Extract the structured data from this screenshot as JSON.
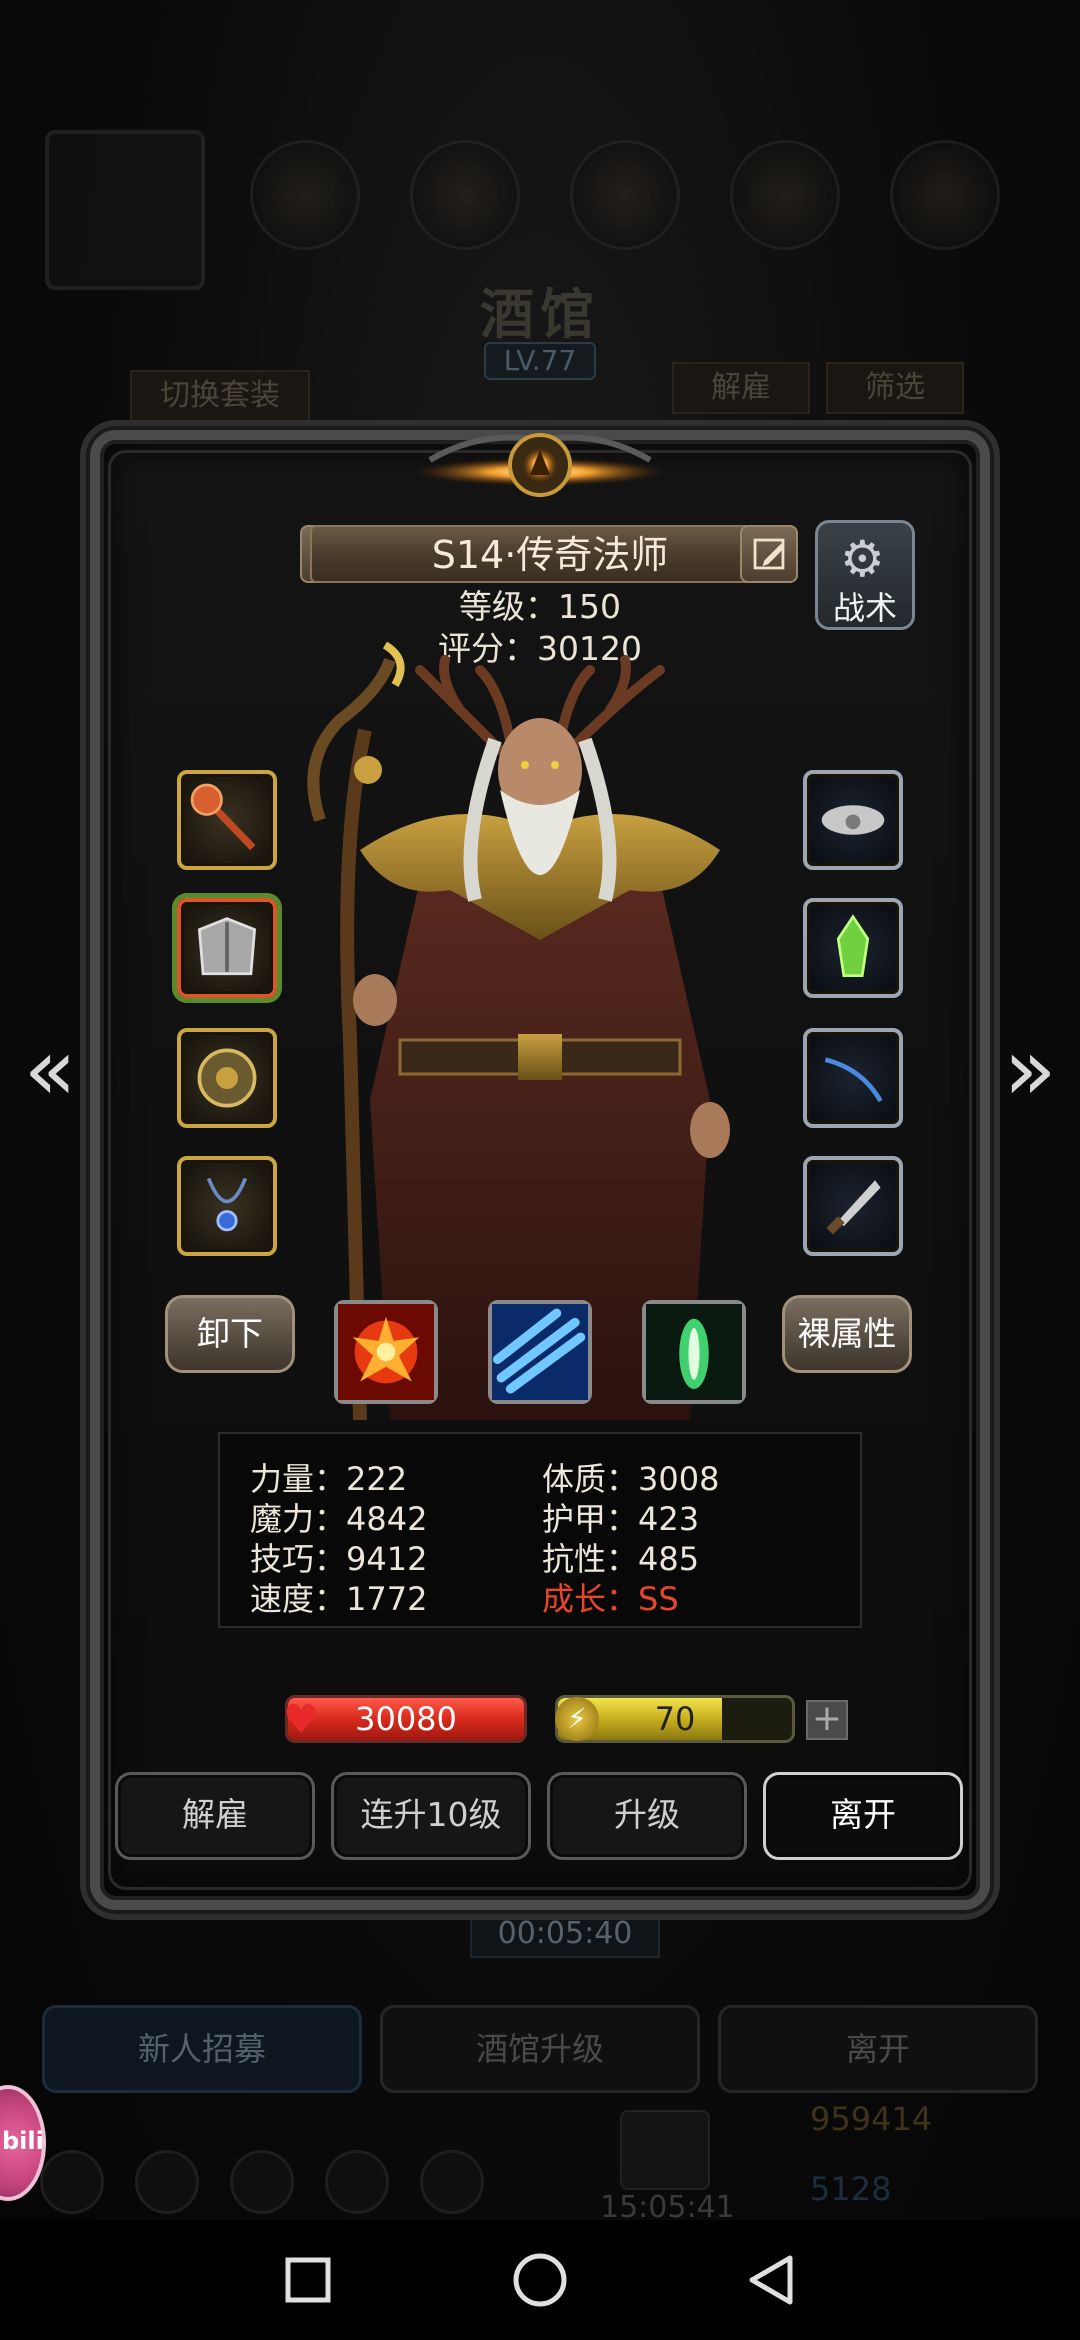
{
  "background": {
    "title": "酒馆",
    "level": "LV.77",
    "switch_outfit": "切换套装",
    "dismiss_small": "解雇",
    "filter": "筛选",
    "timer": "00:05:40",
    "recruit": "新人招募",
    "tavern_upgrade": "酒馆升级",
    "leave": "离开",
    "gold": "959414",
    "gems": "5128",
    "clock": "15:05:41",
    "bili_label": "bili"
  },
  "hero": {
    "name": "S14·传奇法师",
    "level_text": "等级：150",
    "score_text": "评分：30120"
  },
  "tactics": {
    "label": "战术",
    "icon": "gear-icon"
  },
  "buttons": {
    "unequip": "卸下",
    "base_attr": "裸属性"
  },
  "stats": {
    "strength": "力量：222",
    "magic": "魔力：4842",
    "skill": "技巧：9412",
    "speed": "速度：1772",
    "constitution": "体质：3008",
    "armor": "护甲：423",
    "resistance": "抗性：485",
    "growth": "成长：SS"
  },
  "bars": {
    "hp": "30080",
    "hp_fill_fraction": 1.0,
    "energy": "70",
    "energy_fill_fraction": 0.7,
    "plus": "+"
  },
  "actions": {
    "dismiss": "解雇",
    "level10": "连升10级",
    "upgrade": "升级",
    "leave": "离开"
  },
  "colors": {
    "growth": "#e8462a",
    "gold_frame": "#c9a640",
    "hp": "#d82a1c",
    "energy": "#c8b020"
  }
}
